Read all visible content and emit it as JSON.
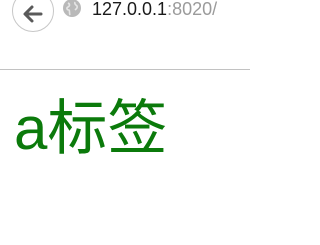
{
  "browser": {
    "address_bar": {
      "host": "127.0.0.1",
      "port_path": ":8020/"
    },
    "icons": {
      "back": "back-arrow-icon",
      "site": "globe-icon"
    },
    "colors": {
      "divider": "#c2c2c2",
      "url_host": "#1a1a1a",
      "url_port": "#9b9b9b"
    }
  },
  "page": {
    "link_text": "a标签",
    "link_color": "#0b7a0b"
  }
}
